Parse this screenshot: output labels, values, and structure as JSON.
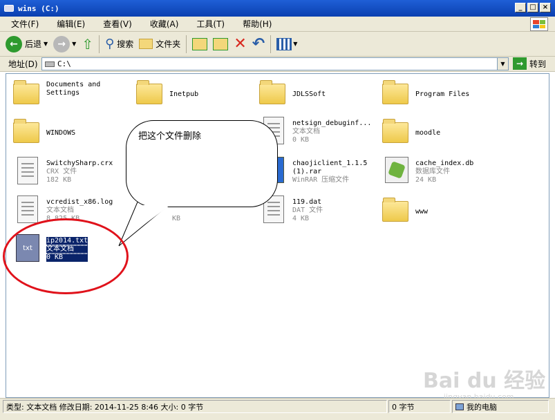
{
  "window": {
    "title": "wins (C:)",
    "controls": [
      "_",
      "□",
      "×"
    ]
  },
  "menu": [
    "文件(F)",
    "编辑(E)",
    "查看(V)",
    "收藏(A)",
    "工具(T)",
    "帮助(H)"
  ],
  "toolbar": {
    "back": "后退",
    "search": "搜索",
    "folders": "文件夹"
  },
  "address": {
    "label": "地址(D)",
    "value": "C:\\",
    "go": "转到"
  },
  "files": [
    {
      "name": "Documents and",
      "name2": "Settings",
      "icon": "folder-icon"
    },
    {
      "name": "Inetpub",
      "icon": "folder-icon"
    },
    {
      "name": "JDLSSoft",
      "icon": "folder-icon"
    },
    {
      "name": "Program Files",
      "icon": "folder-icon"
    },
    {
      "name": "WINDOWS",
      "icon": "folder-icon"
    },
    {
      "name": "netsign_debuginf...",
      "type": "文本文档",
      "size": "0 KB",
      "icon": "text-file-icon"
    },
    {
      "name": "moodle",
      "icon": "folder-icon"
    },
    {
      "name": "SwitchySharp.crx",
      "type": "CRX 文件",
      "size": "182 KB",
      "icon": "crx-file-icon"
    },
    {
      "name": "chaojiclient_1.1.5",
      "name2": "(1).rar",
      "type": "WinRAR 压缩文件",
      "icon": "rar-file-icon"
    },
    {
      "name": "cache_index.db",
      "type": "数据库文件",
      "size": "24 KB",
      "icon": "database-file-icon"
    },
    {
      "name": "vcredist_x86.log",
      "type": "文本文档",
      "size": "8,825 KB",
      "icon": "log-file-icon"
    },
    {
      "name": "KB",
      "icon": "file-icon"
    },
    {
      "name": "119.dat",
      "type": "DAT 文件",
      "size": "4 KB",
      "icon": "dat-file-icon"
    },
    {
      "name": "www",
      "icon": "folder-icon"
    },
    {
      "name": "ip2014.txt",
      "type": "文本文档",
      "size": "0 KB",
      "icon": "txt-file-icon"
    }
  ],
  "callout": {
    "text": "把这个文件删除"
  },
  "status": {
    "info": "类型: 文本文档 修改日期: 2014-11-25 8:46 大小: 0 字节",
    "size": "0 字节",
    "location": "我的电脑"
  },
  "watermark": {
    "text": "Bai du 经验",
    "sub": "jingyan.baidu.com"
  }
}
